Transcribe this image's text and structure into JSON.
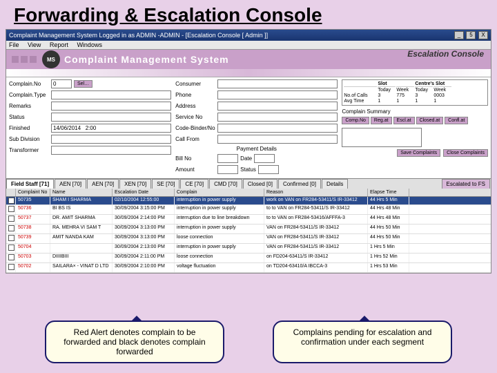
{
  "slide_title": "Forwarding & Escalation Console",
  "titlebar": "Complaint Management System Logged in as ADMIN -ADMIN - [Escalation Console [ Admin ]]",
  "win_btns": [
    "_",
    "5",
    "X"
  ],
  "menu": [
    "File",
    "View",
    "Report",
    "Windows"
  ],
  "banner": {
    "logo": "MS",
    "title_a": "Complaint",
    "title_b": "Management",
    "title_c": "System",
    "sub": "Escalation Console"
  },
  "form": {
    "complain_no_lbl": "Complain.No",
    "complain_no": "0",
    "select_btn": "Sel…",
    "complain_type_lbl": "Complain.Type",
    "remarks_lbl": "Remarks",
    "status_lbl": "Status",
    "finished_lbl": "Finished",
    "finished": "14/06/2014   2:00",
    "subdiv_lbl": "Sub Division",
    "transformer_lbl": "Transformer",
    "consumer_lbl": "Consumer",
    "phone_lbl": "Phone",
    "address_lbl": "Address",
    "service_lbl": "Service No",
    "codebinder_lbl": "Code-Binder/No",
    "callfrom_lbl": "Call From",
    "payment_lbl": "Payment Details",
    "billno_lbl": "Bill No",
    "date_lbl": "Date",
    "amount_lbl": "Amount",
    "pstatus_lbl": "Status",
    "complain_summary_lbl": "Complain Summary"
  },
  "stats": {
    "h1": "",
    "h2": "Slot",
    "h3": "",
    "h4": "Centre's Slot",
    "h5": "",
    "r1": "",
    "r2": "Today",
    "r3": "Week",
    "r4": "Today",
    "r5": "Week",
    "a1": "No.of Calls",
    "a2": "3",
    "a3": "775",
    "a4": "3",
    "a5": "0003",
    "b1": "Avg Time",
    "b2": "1",
    "b3": "1",
    "b4": "1",
    "b5": "1"
  },
  "complain_tabs": [
    "Comp.No",
    "Reg.at",
    "Escl.at",
    "Closed.at",
    "Confl.at"
  ],
  "save_btn": "Save Complaints",
  "close_btn": "Close Complaints",
  "tabs": [
    {
      "label": "Field Staff [71]",
      "active": true
    },
    {
      "label": "AEN [70]"
    },
    {
      "label": "AEN [70]"
    },
    {
      "label": "XEN [70]"
    },
    {
      "label": "SE [70]"
    },
    {
      "label": "CE [70]"
    },
    {
      "label": "CMD [70]"
    },
    {
      "label": "Closed [0]"
    },
    {
      "label": "Confirmed [0]"
    },
    {
      "label": "Details"
    }
  ],
  "esc_tab": "Escalated to FS",
  "grid_headers": [
    "",
    "Complaint No",
    "Name",
    "Escalation Date",
    "Complain",
    "Reason",
    "Elapse Time"
  ],
  "rows": [
    {
      "chk": "✓",
      "no": "50735",
      "name": "SHAM I SHARMA",
      "date": "02/10/2004 12:55:00",
      "comp": "interruption in power supply",
      "reason": "work on VAN on FR284-53411/S IR-33412",
      "elapse": "44 Hrs 5 Min",
      "sel": true
    },
    {
      "chk": "",
      "no": "50736",
      "name": "BI BS IS",
      "date": "30/09/2004 3:15:00 PM",
      "comp": "interruption in power supply",
      "reason": "to to VAN on FR284-53411/S IR-33412",
      "elapse": "44 Hrs 48 Min"
    },
    {
      "chk": "",
      "no": "50737",
      "name": "DR. AMIT SHARMA",
      "date": "30/09/2004 2:14:00 PM",
      "comp": "interruption due to line breakdown",
      "reason": "to to VAN on FR284-53416/AFFFA-3",
      "elapse": "44 Hrs 48 Min"
    },
    {
      "chk": "",
      "no": "50738",
      "name": "RA. MEHRA VI SAM T",
      "date": "30/09/2004 3:13:00 PM",
      "comp": "interruption in power supply",
      "reason": "VAN on FR284-53411/S IR-33412",
      "elapse": "44 Hrs 50 Min"
    },
    {
      "chk": "",
      "no": "50739",
      "name": "AMIT NANDA KAM",
      "date": "30/09/2004 3:13:00 PM",
      "comp": "loose connection",
      "reason": "VAN on FR284-53411/S IR-33412",
      "elapse": "44 Hrs 50 Min"
    },
    {
      "chk": "",
      "no": "50704",
      "name": "",
      "date": "30/09/2004 2:13:00 PM",
      "comp": "interruption in power supply",
      "reason": "VAN on FR284-53411/S IR-33412",
      "elapse": "1 Hrs 5 Min"
    },
    {
      "chk": "",
      "no": "50703",
      "name": "DIIIIBIII",
      "date": "30/09/2004 2:11:00 PM",
      "comp": "loose connection",
      "reason": "on FD204-63411/S IR-33412",
      "elapse": "1 Hrs 52 Min"
    },
    {
      "chk": "",
      "no": "50702",
      "name": "SAILARA× - VINAT D LTD",
      "date": "30/09/2004 2:10:00 PM",
      "comp": "voltage fluctuation",
      "reason": "on TD204-63410/A IBCCA-3",
      "elapse": "1 Hrs 53 Min"
    }
  ],
  "callouts": {
    "left": "Red Alert denotes complain to be forwarded and black denotes complain forwarded",
    "right": "Complains pending for escalation and confirmation under each segment"
  }
}
